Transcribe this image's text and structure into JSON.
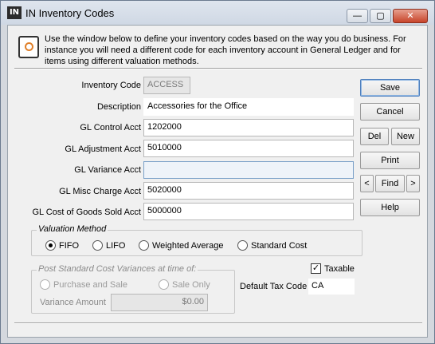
{
  "window": {
    "icon_text": "IN",
    "title": "IN Inventory Codes",
    "minimize": "—",
    "maximize": "▢",
    "close": "✕"
  },
  "info": "Use the window below to define your inventory codes based on the way you do business.  For instance you will need a different code for each inventory account in General Ledger and for items using different valuation methods.",
  "form": {
    "inventory_code": {
      "label": "Inventory Code",
      "value": "ACCESS"
    },
    "description": {
      "label": "Description",
      "value": "Accessories for the Office"
    },
    "gl_control": {
      "label": "GL Control Acct",
      "value": "1202000"
    },
    "gl_adjustment": {
      "label": "GL Adjustment Acct",
      "value": "5010000"
    },
    "gl_variance": {
      "label": "GL Variance Acct",
      "value": ""
    },
    "gl_misc_charge": {
      "label": "GL Misc Charge Acct",
      "value": "5020000"
    },
    "gl_cogs": {
      "label": "GL Cost of Goods Sold Acct",
      "value": "5000000"
    }
  },
  "buttons": {
    "save": "Save",
    "cancel": "Cancel",
    "del": "Del",
    "new": "New",
    "print": "Print",
    "prev": "<",
    "find": "Find",
    "next": ">",
    "help": "Help"
  },
  "valuation": {
    "title": "Valuation Method",
    "options": [
      "FIFO",
      "LIFO",
      "Weighted Average",
      "Standard Cost"
    ],
    "selected": "FIFO"
  },
  "variances": {
    "title": "Post Standard Cost Variances at time of:",
    "options": [
      "Purchase and Sale",
      "Sale Only"
    ],
    "amount_label": "Variance Amount",
    "amount_value": "$0.00"
  },
  "tax": {
    "taxable_label": "Taxable",
    "taxable_checked": true,
    "check_mark": "✓",
    "default_code_label": "Default Tax Code",
    "default_code_value": "CA"
  }
}
